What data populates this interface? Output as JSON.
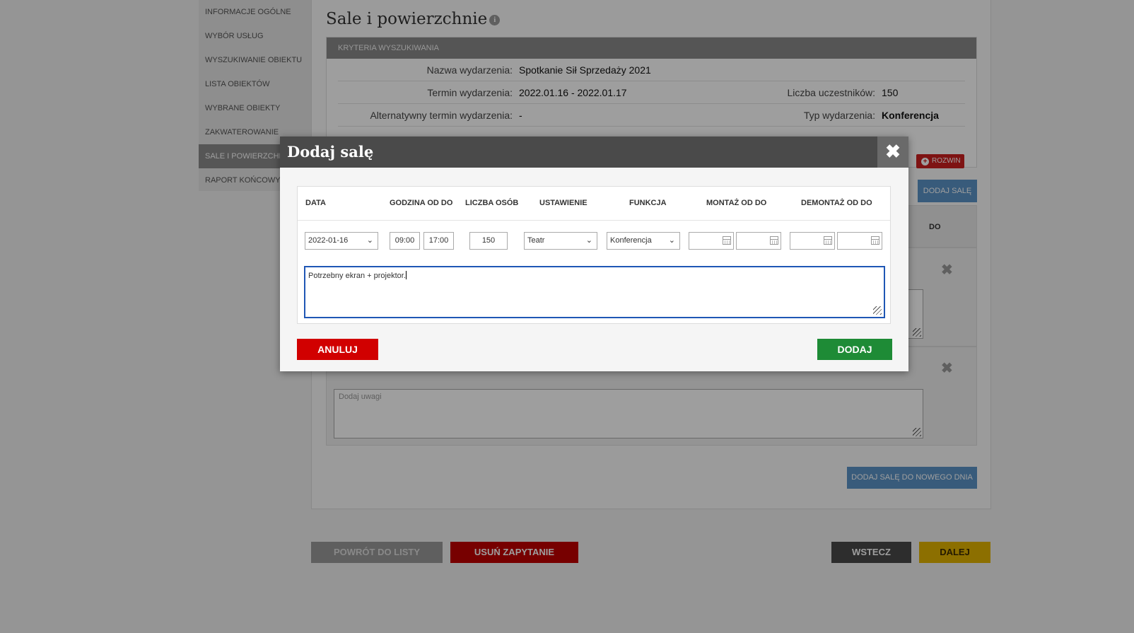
{
  "sidebar": {
    "items": [
      {
        "label": "INFORMACJE OGÓLNE"
      },
      {
        "label": "WYBÓR USŁUG"
      },
      {
        "label": "WYSZUKIWANIE OBIEKTU"
      },
      {
        "label": "LISTA OBIEKTÓW"
      },
      {
        "label": "WYBRANE OBIEKTY"
      },
      {
        "label": "ZAKWATEROWANIE"
      },
      {
        "label": "SALE I POWIERZCHNIE"
      },
      {
        "label": "RAPORT KOŃCOWY"
      }
    ],
    "active_index": 6
  },
  "page": {
    "title": "Sale i powierzchnie",
    "info_icon": "info-icon"
  },
  "criteria": {
    "header": "KRYTERIA WYSZUKIWANIA",
    "event_name_label": "Nazwa wydarzenia:",
    "event_name_value": "Spotkanie Sił Sprzedaży 2021",
    "event_date_label": "Termin wydarzenia:",
    "event_date_value": "2022.01.16 - 2022.01.17",
    "participants_label": "Liczba uczestników:",
    "participants_value": "150",
    "alt_date_label": "Alternatywny termin wydarzenia:",
    "alt_date_value": "-",
    "event_type_label": "Typ wydarzenia:",
    "event_type_value": "Konferencja",
    "expand_label": "ROZWIN"
  },
  "background": {
    "add_hall_label": "DODAJ SALĘ",
    "col_fragment": "DO",
    "notes_placeholder": "Dodaj uwagi",
    "add_hall_new_day_label": "DODAJ SALĘ DO NOWEGO DNIA"
  },
  "bottom_bar": {
    "back_to_list": "POWRÓT DO LISTY",
    "delete_request": "USUŃ ZAPYTANIE",
    "back": "WSTECZ",
    "next": "DALEJ"
  },
  "modal": {
    "title": "Dodaj salę",
    "close_icon": "close-icon",
    "columns": [
      "DATA",
      "GODZINA OD DO",
      "LICZBA OSÓB",
      "USTAWIENIE",
      "FUNKCJA",
      "MONTAŻ OD DO",
      "DEMONTAŻ OD DO"
    ],
    "date_value": "2022-01-16",
    "time_from": "09:00",
    "time_to": "17:00",
    "people": "150",
    "setup_value": "Teatr",
    "function_value": "Konferencja",
    "setup_from": "",
    "setup_to": "",
    "teardown_from": "",
    "teardown_to": "",
    "notes": "Potrzebny ekran + projektor.",
    "cancel_label": "ANULUJ",
    "add_label": "DODAJ"
  },
  "colors": {
    "accent_blue": "#5b93c7",
    "danger_red": "#d10000",
    "success_green": "#1e8b36",
    "next_yellow": "#e3b300",
    "focus_blue": "#1f57b5"
  }
}
